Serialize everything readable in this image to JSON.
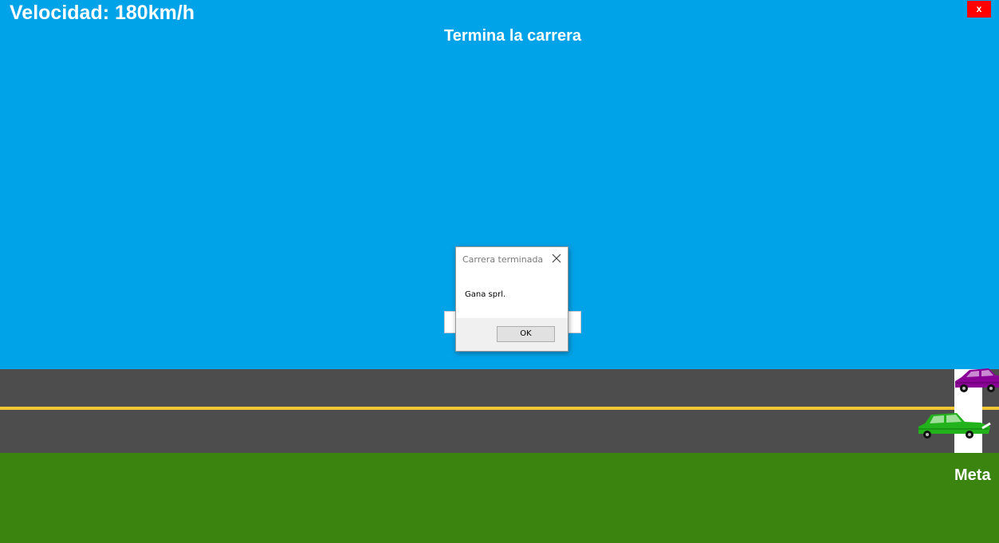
{
  "hud": {
    "speed_text": "Velocidad: 180km/h",
    "instruction": "Termina la carrera",
    "close_label": "x"
  },
  "track": {
    "finish_label": "Meta"
  },
  "dialog": {
    "title": "Carrera terminada",
    "message": "Gana sprl.",
    "ok_label": "OK"
  },
  "colors": {
    "sky": "#00a2e8",
    "road": "#4d4d4d",
    "center_line": "#f5c631",
    "grass": "#3b840f",
    "close_button": "#ff0000",
    "car_purple": "#8a0096",
    "car_green": "#22b21c"
  },
  "icons": {
    "dialog_close": "close-icon",
    "car_1": "purple-car-icon",
    "car_2": "green-car-icon"
  }
}
